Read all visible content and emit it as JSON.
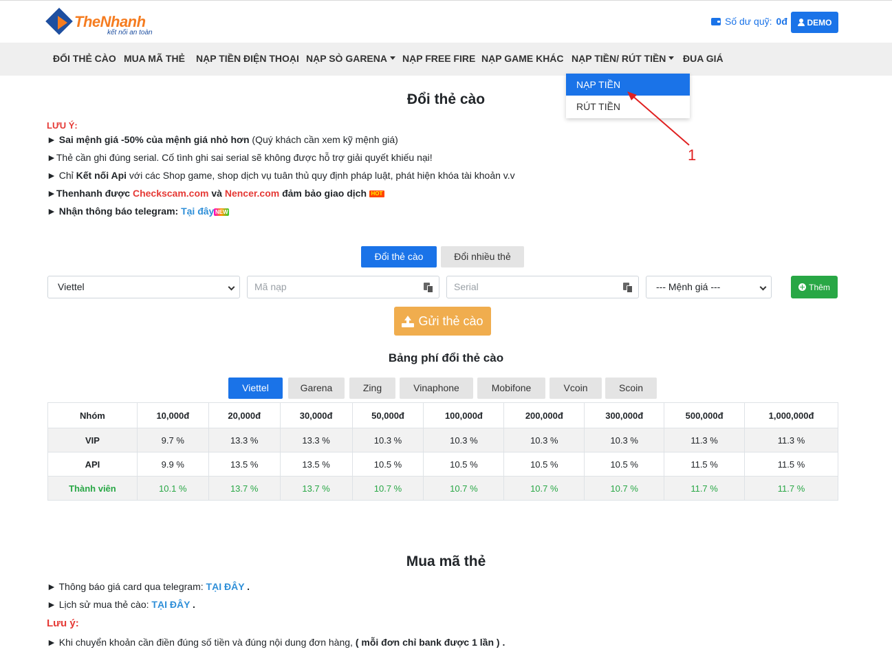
{
  "header": {
    "brand": "TheNhanh",
    "tagline": "kết nối an toàn",
    "balance_label": "Số dư quỹ:",
    "balance_value": "0đ",
    "user_label": "DEMO"
  },
  "nav": {
    "items": [
      {
        "label": "ĐỔI THẺ CÀO"
      },
      {
        "label": "MUA MÃ THẺ"
      },
      {
        "label": "NẠP TIỀN ĐIỆN THOẠI"
      },
      {
        "label": "NẠP SÒ GARENA"
      },
      {
        "label": "NẠP FREE FIRE"
      },
      {
        "label": "NẠP GAME KHÁC"
      },
      {
        "label": "NẠP TIỀN/ RÚT TIỀN"
      },
      {
        "label": "ĐUA GIÁ"
      }
    ],
    "dropdown": [
      {
        "label": "NẠP TIỀN"
      },
      {
        "label": "RÚT TIỀN"
      }
    ]
  },
  "annotation": {
    "label": "1",
    "color": "#e02020"
  },
  "exchange": {
    "title": "Đổi thẻ cào",
    "note_heading": "LƯU Ý:",
    "note1_bold": "Sai mệnh giá -50% của mệnh giá nhỏ hơn",
    "note1_rest": " (Quý khách cần xem kỹ mệnh giá)",
    "note2": "Thẻ cần ghi đúng serial. Cố tình ghi sai serial sẽ không được hỗ trợ giải quyết khiếu nại!",
    "note3_a": " Chỉ ",
    "note3_bold": "Kết nối Api",
    "note3_b": " với các Shop game, shop dịch vụ tuân thủ quy định pháp luật, phát hiện khóa tài khoản v.v",
    "note4_a": "Thenhanh được ",
    "note4_link1": "Checkscam.com",
    "note4_and": " và ",
    "note4_link2": "Nencer.com",
    "note4_b": " đảm bảo giao dịch",
    "note4_badge": "HOT",
    "note5_a": " Nhận thông báo telegram: ",
    "note5_link": "Tại đây",
    "note5_badge": "NEW",
    "tab_single": "Đổi thẻ cào",
    "tab_multi": "Đổi nhiều thẻ",
    "telco_value": "Viettel",
    "code_placeholder": "Mã nạp",
    "serial_placeholder": "Serial",
    "amount_value": "--- Mệnh giá ---",
    "add_label": "Thêm",
    "submit_label": "Gửi thẻ cào"
  },
  "fees": {
    "title": "Bảng phí đổi thẻ cào",
    "tabs": [
      "Viettel",
      "Garena",
      "Zing",
      "Vinaphone",
      "Mobifone",
      "Vcoin",
      "Scoin"
    ],
    "columns": [
      "Nhóm",
      "10,000đ",
      "20,000đ",
      "30,000đ",
      "50,000đ",
      "100,000đ",
      "200,000đ",
      "300,000đ",
      "500,000đ",
      "1,000,000đ"
    ],
    "rows": [
      {
        "group": "VIP",
        "values": [
          "9.7 %",
          "13.3 %",
          "13.3 %",
          "10.3 %",
          "10.3 %",
          "10.3 %",
          "10.3 %",
          "11.3 %",
          "11.3 %"
        ]
      },
      {
        "group": "API",
        "values": [
          "9.9 %",
          "13.5 %",
          "13.5 %",
          "10.5 %",
          "10.5 %",
          "10.5 %",
          "10.5 %",
          "11.5 %",
          "11.5 %"
        ]
      },
      {
        "group": "Thành viên",
        "values": [
          "10.1 %",
          "13.7 %",
          "13.7 %",
          "10.7 %",
          "10.7 %",
          "10.7 %",
          "10.7 %",
          "11.7 %",
          "11.7 %"
        ]
      }
    ]
  },
  "buy": {
    "title": "Mua mã thẻ",
    "line1_a": " Thông báo giá card qua telegram: ",
    "line1_link": "TẠI ĐÂY",
    "line1_b": " .",
    "line2_a": " Lịch sử mua thẻ cào: ",
    "line2_link": "TẠI ĐÂY",
    "line2_b": " .",
    "note_heading": "Lưu ý:",
    "line3_a": " Khi chuyển khoản cần điền đúng số tiền và đúng nội dung đơn hàng, ",
    "line3_bold": "( mỗi đơn chỉ bank được 1 lần )",
    "line3_b": " ."
  }
}
